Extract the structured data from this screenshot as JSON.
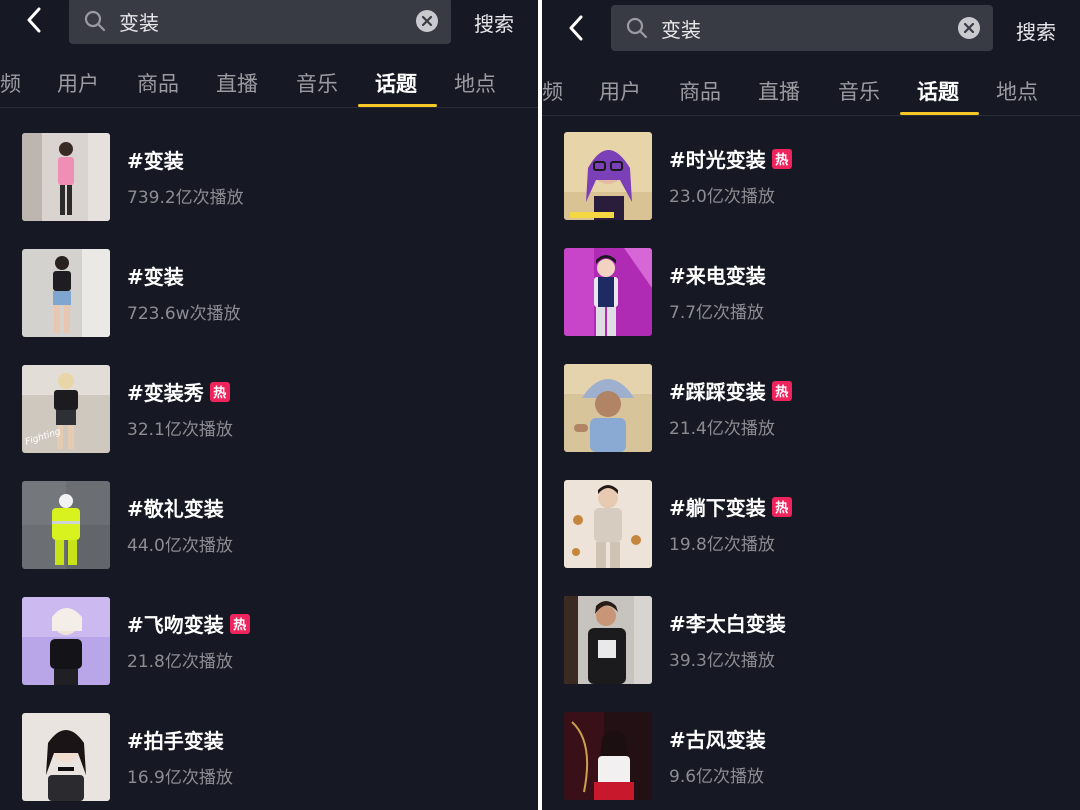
{
  "colors": {
    "background": "#161823",
    "accent_underline": "#f5c825",
    "hot_badge": "#f0245c",
    "search_box": "#393b44"
  },
  "screens": [
    {
      "search": {
        "query": "变装",
        "button_label": "搜索"
      },
      "tabs": [
        "频",
        "用户",
        "商品",
        "直播",
        "音乐",
        "话题",
        "地点"
      ],
      "active_tab": "话题",
      "topics": [
        {
          "title": "#变装",
          "plays": "739.2亿次播放",
          "hot": ""
        },
        {
          "title": "#变装",
          "plays": "723.6w次播放",
          "hot": ""
        },
        {
          "title": "#变装秀",
          "plays": "32.1亿次播放",
          "hot": "热"
        },
        {
          "title": "#敬礼变装",
          "plays": "44.0亿次播放",
          "hot": ""
        },
        {
          "title": "#飞吻变装",
          "plays": "21.8亿次播放",
          "hot": "热"
        },
        {
          "title": "#拍手变装",
          "plays": "16.9亿次播放",
          "hot": ""
        }
      ]
    },
    {
      "search": {
        "query": "变装",
        "button_label": "搜索"
      },
      "tabs": [
        "频",
        "用户",
        "商品",
        "直播",
        "音乐",
        "话题",
        "地点"
      ],
      "active_tab": "话题",
      "topics": [
        {
          "title": "#时光变装",
          "plays": "23.0亿次播放",
          "hot": "热"
        },
        {
          "title": "#来电变装",
          "plays": "7.7亿次播放",
          "hot": ""
        },
        {
          "title": "#踩踩变装",
          "plays": "21.4亿次播放",
          "hot": "热"
        },
        {
          "title": "#躺下变装",
          "plays": "19.8亿次播放",
          "hot": "热"
        },
        {
          "title": "#李太白变装",
          "plays": "39.3亿次播放",
          "hot": ""
        },
        {
          "title": "#古风变装",
          "plays": "9.6亿次播放",
          "hot": ""
        }
      ]
    }
  ]
}
